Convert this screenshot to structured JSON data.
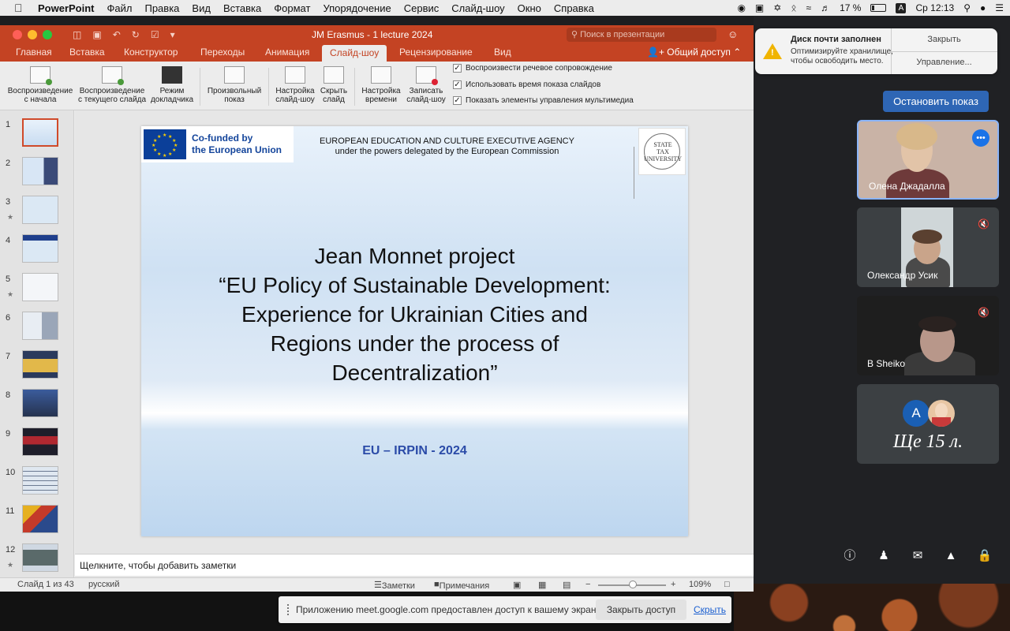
{
  "menubar": {
    "app": "PowerPoint",
    "items": [
      "Файл",
      "Правка",
      "Вид",
      "Вставка",
      "Формат",
      "Упорядочение",
      "Сервис",
      "Слайд-шоу",
      "Окно",
      "Справка"
    ],
    "battery": "17 %",
    "input_lang": "A",
    "clock": "Ср 12:13"
  },
  "ppt": {
    "doc_title": "JM Erasmus - 1 lecture 2024",
    "search_placeholder": "Поиск в презентации",
    "tabs": [
      "Главная",
      "Вставка",
      "Конструктор",
      "Переходы",
      "Анимация",
      "Слайд-шоу",
      "Рецензирование",
      "Вид"
    ],
    "active_tab": "Слайд-шоу",
    "share_label": "Общий доступ",
    "ribbon": {
      "from_start": [
        "Воспроизведение",
        "с начала"
      ],
      "from_current": [
        "Воспроизведение",
        "с текущего слайда"
      ],
      "presenter": [
        "Режим",
        "докладчика"
      ],
      "custom": [
        "Произвольный",
        "показ"
      ],
      "setup": [
        "Настройка",
        "слайд-шоу"
      ],
      "hide": [
        "Скрыть",
        "слайд"
      ],
      "timing": [
        "Настройка",
        "времени"
      ],
      "record": [
        "Записать",
        "слайд-шоу"
      ],
      "checks": [
        "Воспроизвести речевое сопровождение",
        "Использовать время показа слайдов",
        "Показать элементы управления мультимедиа"
      ]
    },
    "thumbs": [
      "1",
      "2",
      "3",
      "4",
      "5",
      "6",
      "7",
      "8",
      "9",
      "10",
      "11",
      "12"
    ],
    "slide": {
      "eu_line1": "Co-funded by",
      "eu_line2": "the European Union",
      "agency_line1": "EUROPEAN EDUCATION AND CULTURE EXECUTIVE AGENCY",
      "agency_line2": "under the powers delegated by the European Commission",
      "uni_line1": "STATE",
      "uni_line2": "TAX",
      "uni_line3": "UNIVERSITY",
      "title_lines": [
        "Jean Monnet project",
        "“EU Policy of Sustainable Development:",
        "Experience for Ukrainian Cities and",
        "Regions under the process of",
        "Decentralization”"
      ],
      "subtitle": "EU – IRPIN - 2024"
    },
    "notes_placeholder": "Щелкните, чтобы добавить заметки",
    "status": {
      "slide_info": "Слайд 1 из 43",
      "language": "русский",
      "notes": "Заметки",
      "comments": "Примечания",
      "zoom": "109%"
    }
  },
  "notification": {
    "title": "Диск почти заполнен",
    "body": "Оптимизируйте хранилище, чтобы освободить место.",
    "close": "Закрыть",
    "manage": "Управление..."
  },
  "meet": {
    "stop_present": "Остановить показ",
    "participants": [
      {
        "name": "Олена Джадалла"
      },
      {
        "name": "Олександр Усик"
      },
      {
        "name": "B Sheiko"
      }
    ],
    "avatar_letter": "A",
    "more_label": "Ще 15 л."
  },
  "share_bar": {
    "message": "Приложению meet.google.com предоставлен доступ к вашему экрану.",
    "stop": "Закрыть доступ",
    "hide": "Скрыть"
  }
}
